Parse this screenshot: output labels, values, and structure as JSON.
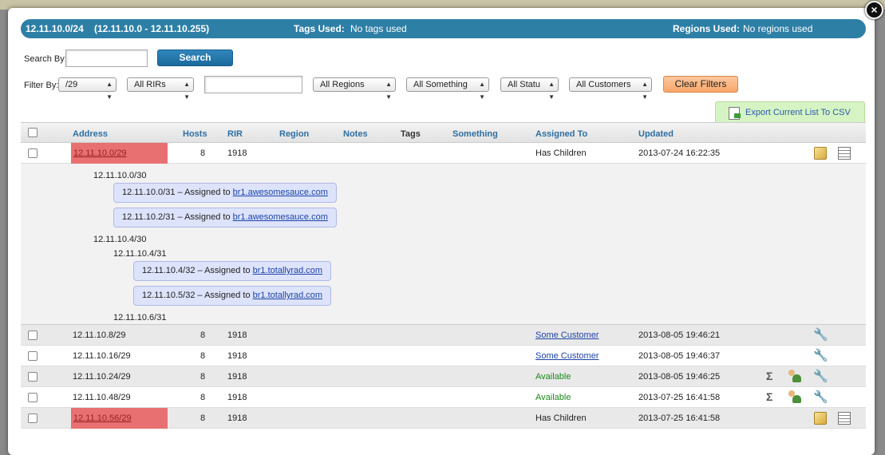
{
  "header": {
    "subnet": "12.11.10.0/24",
    "range": "(12.11.10.0 - 12.11.10.255)",
    "tags_label": "Tags Used:",
    "tags_value": "No tags used",
    "regions_label": "Regions Used:",
    "regions_value": "No regions used"
  },
  "close_label": "×",
  "search": {
    "label": "Search By:",
    "value": "",
    "button": "Search"
  },
  "filter": {
    "label": "Filter By:",
    "prefix": "/29",
    "rir": "All RIRs",
    "text_value": "",
    "region": "All Regions",
    "something": "All Something",
    "status": "All Statu",
    "customer": "All Customers",
    "clear_button": "Clear Filters"
  },
  "export_label": "Export Current List To CSV",
  "columns": {
    "address": "Address",
    "hosts": "Hosts",
    "rir": "RIR",
    "region": "Region",
    "notes": "Notes",
    "tags": "Tags",
    "something": "Something",
    "assigned_to": "Assigned To",
    "updated": "Updated"
  },
  "rows": [
    {
      "address": "12.11.10.0/29",
      "hosts": "8",
      "rir": "1918",
      "assigned_to": "Has Children",
      "updated": "2013-07-24 16:22:35"
    },
    {
      "address": "12.11.10.8/29",
      "hosts": "8",
      "rir": "1918",
      "assigned_to": "Some Customer",
      "updated": "2013-08-05 19:46:21"
    },
    {
      "address": "12.11.10.16/29",
      "hosts": "8",
      "rir": "1918",
      "assigned_to": "Some Customer",
      "updated": "2013-08-05 19:46:37"
    },
    {
      "address": "12.11.10.24/29",
      "hosts": "8",
      "rir": "1918",
      "assigned_to": "Available",
      "updated": "2013-08-05 19:46:25"
    },
    {
      "address": "12.11.10.48/29",
      "hosts": "8",
      "rir": "1918",
      "assigned_to": "Available",
      "updated": "2013-07-25 16:41:58"
    },
    {
      "address": "12.11.10.56/29",
      "hosts": "8",
      "rir": "1918",
      "assigned_to": "Has Children",
      "updated": "2013-07-25 16:41:58"
    }
  ],
  "children": {
    "n1": "12.11.10.0/30",
    "p1": {
      "prefix": "12.11.10.0/31 – Assigned to ",
      "link": "br1.awesomesauce.com"
    },
    "p2": {
      "prefix": "12.11.10.2/31 – Assigned to ",
      "link": "br1.awesomesauce.com"
    },
    "n2": "12.11.10.4/30",
    "n3": "12.11.10.4/31",
    "p3": {
      "prefix": "12.11.10.4/32 – Assigned to ",
      "link": "br1.totallyrad.com"
    },
    "p4": {
      "prefix": "12.11.10.5/32 – Assigned to ",
      "link": "br1.totallyrad.com"
    },
    "n4": "12.11.10.6/31"
  },
  "icons": {
    "edit": "edit-icon",
    "list": "list-icon",
    "wrench": "wrench-icon",
    "sigma": "sigma-icon",
    "user": "assign-user-icon",
    "export": "csv-icon"
  }
}
